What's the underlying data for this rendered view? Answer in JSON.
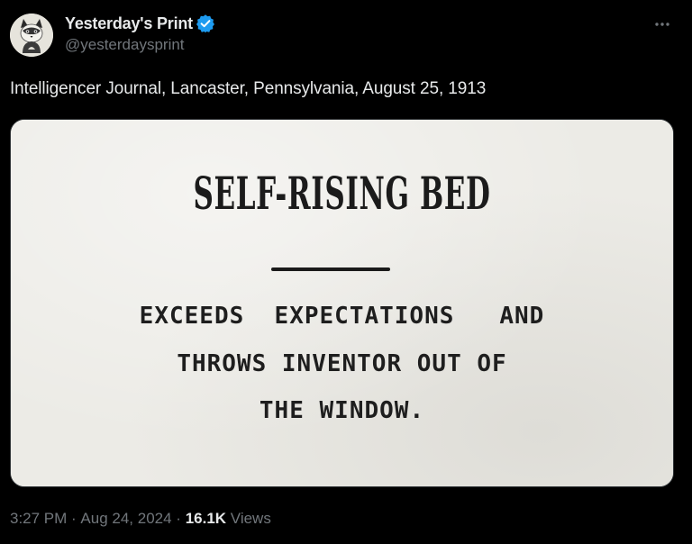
{
  "author": {
    "display_name": "Yesterday's Print",
    "handle": "@yesterdaysprint",
    "verified": true,
    "verified_color": "#1d9bf0",
    "avatar_icon": "cat-avatar-icon"
  },
  "more_icon": "ellipsis-icon",
  "tweet": {
    "text": "Intelligencer Journal, Lancaster, Pennsylvania, August 25, 1913"
  },
  "media": {
    "headline": "SELF-RISING BED",
    "sub_line_1": "EXCEEDS  EXPECTATIONS   AND",
    "sub_line_2": "THROWS INVENTOR OUT OF",
    "sub_line_3": "THE WINDOW."
  },
  "meta": {
    "time": "3:27 PM",
    "separator_1": " · ",
    "date": "Aug 24, 2024",
    "separator_2": " · ",
    "views_count": "16.1K",
    "views_label": " Views"
  },
  "colors": {
    "background": "#000000",
    "text_primary": "#e7e9ea",
    "text_secondary": "#71767b"
  }
}
